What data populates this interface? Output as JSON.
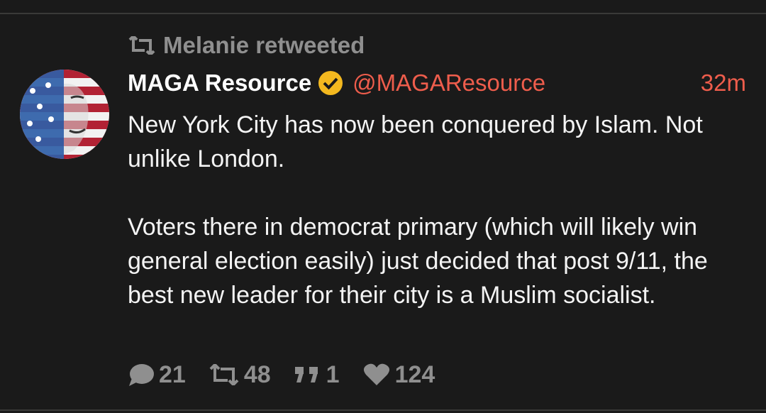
{
  "retweet": {
    "icon": "retweet-icon",
    "text": "Melanie retweeted"
  },
  "tweet": {
    "display_name": "MAGA Resource",
    "verified_icon": "verified-badge-icon",
    "handle": "@MAGAResource",
    "time": "32m",
    "paragraphs": [
      "New York City has now been conquered by Islam. Not unlike London.",
      "Voters there in democrat primary (which will likely win general election easily) just decided that post 9/11, the best new leader for their city is a Muslim socialist."
    ]
  },
  "actions": {
    "replies": {
      "icon": "reply-icon",
      "count": "21"
    },
    "retweets": {
      "icon": "retweet-icon",
      "count": "48"
    },
    "quotes": {
      "icon": "quote-icon",
      "count": "1"
    },
    "likes": {
      "icon": "heart-icon",
      "count": "124"
    }
  },
  "colors": {
    "background": "#1a1a1a",
    "accent": "#ee5d4c",
    "muted": "#8f8f8f",
    "verified": "#f3b81f"
  }
}
